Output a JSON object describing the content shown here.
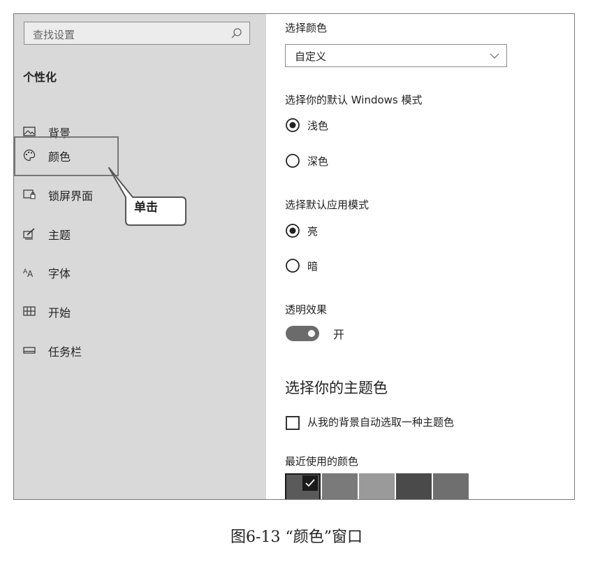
{
  "sidebar": {
    "search_placeholder": "查找设置",
    "section_title": "个性化",
    "items": [
      {
        "label": "背景",
        "icon": "picture-icon"
      },
      {
        "label": "颜色",
        "icon": "palette-icon"
      },
      {
        "label": "锁屏界面",
        "icon": "lock-screen-icon"
      },
      {
        "label": "主题",
        "icon": "theme-brush-icon"
      },
      {
        "label": "字体",
        "icon": "font-icon"
      },
      {
        "label": "开始",
        "icon": "start-grid-icon"
      },
      {
        "label": "任务栏",
        "icon": "taskbar-icon"
      }
    ],
    "callout_text": "单击"
  },
  "main": {
    "choose_color_label": "选择颜色",
    "choose_color_value": "自定义",
    "windows_mode_label": "选择你的默认 Windows 模式",
    "windows_mode_options": [
      {
        "label": "浅色",
        "selected": true
      },
      {
        "label": "深色",
        "selected": false
      }
    ],
    "app_mode_label": "选择默认应用模式",
    "app_mode_options": [
      {
        "label": "亮",
        "selected": true
      },
      {
        "label": "暗",
        "selected": false
      }
    ],
    "transparency_label": "透明效果",
    "transparency_state": "开",
    "accent_heading": "选择你的主题色",
    "auto_pick_label": "从我的背景自动选取一种主题色",
    "recent_colors_label": "最近使用的颜色",
    "recent_colors": [
      "#5a5a5a",
      "#7a7a7a",
      "#9a9a9a",
      "#4a4a4a",
      "#6f6f6f"
    ]
  },
  "caption": "图6-13 “颜色”窗口"
}
